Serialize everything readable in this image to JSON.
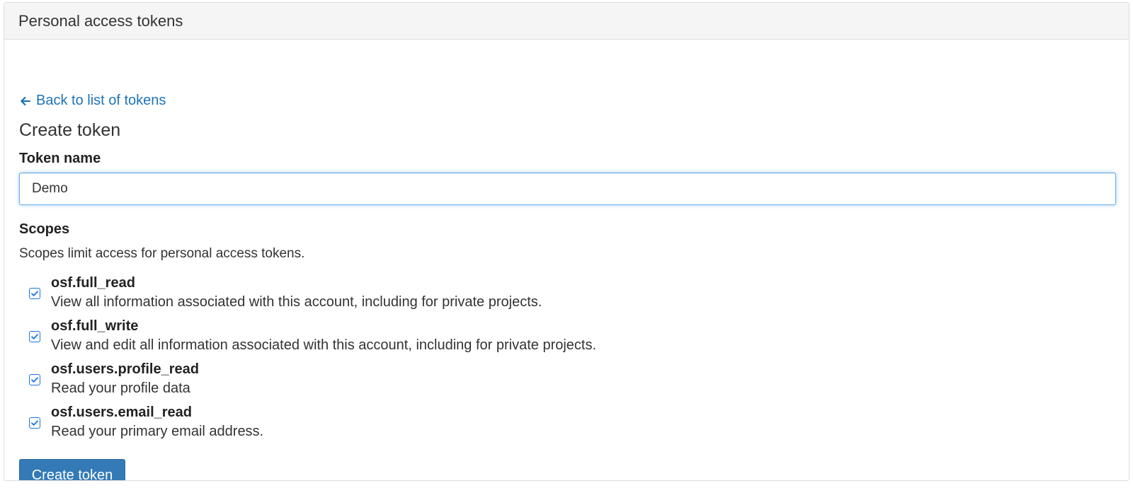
{
  "panel": {
    "title": "Personal access tokens"
  },
  "back_link": {
    "label": "Back to list of tokens"
  },
  "form": {
    "heading": "Create token",
    "token_name_label": "Token name",
    "token_name_value": "Demo",
    "scopes_label": "Scopes",
    "scopes_help": "Scopes limit access for personal access tokens.",
    "scopes": [
      {
        "name": "osf.full_read",
        "description": "View all information associated with this account, including for private projects.",
        "checked": true
      },
      {
        "name": "osf.full_write",
        "description": "View and edit all information associated with this account, including for private projects.",
        "checked": true
      },
      {
        "name": "osf.users.profile_read",
        "description": "Read your profile data",
        "checked": true
      },
      {
        "name": "osf.users.email_read",
        "description": "Read your primary email address.",
        "checked": true
      }
    ],
    "submit_label": "Create token"
  },
  "colors": {
    "link": "#1f73b7",
    "primary": "#337ab7",
    "checkbox": "#1a73e8"
  },
  "icons": {
    "back": "arrow-left-icon",
    "check": "check-icon"
  }
}
